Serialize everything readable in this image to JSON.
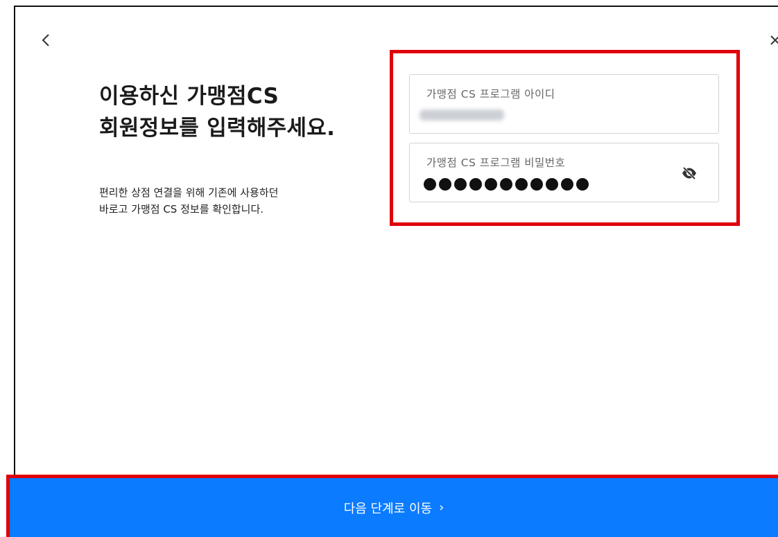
{
  "dialog": {
    "headline": {
      "line1": "이용하신 가맹점CS",
      "line2": "회원정보를 입력해주세요."
    },
    "description": {
      "line1": "편리한 상점 연결을 위해 기존에 사용하던",
      "line2": "바로고 가맹점 CS 정보를 확인합니다."
    },
    "fields": {
      "id": {
        "label": "가맹점 CS 프로그램 아이디"
      },
      "password": {
        "label": "가맹점 CS 프로그램 비밀번호",
        "value": "●●●●●●●●●●●",
        "dot_count": 11
      }
    },
    "next_button": {
      "label": "다음 단계로 이동",
      "chevron": "›"
    },
    "icons": {
      "back": "chevron-left-icon",
      "close": "close-icon",
      "password_toggle": "eye-slash-icon"
    },
    "colors": {
      "primary": "#0b7bff",
      "highlight": "#e0000a"
    }
  }
}
